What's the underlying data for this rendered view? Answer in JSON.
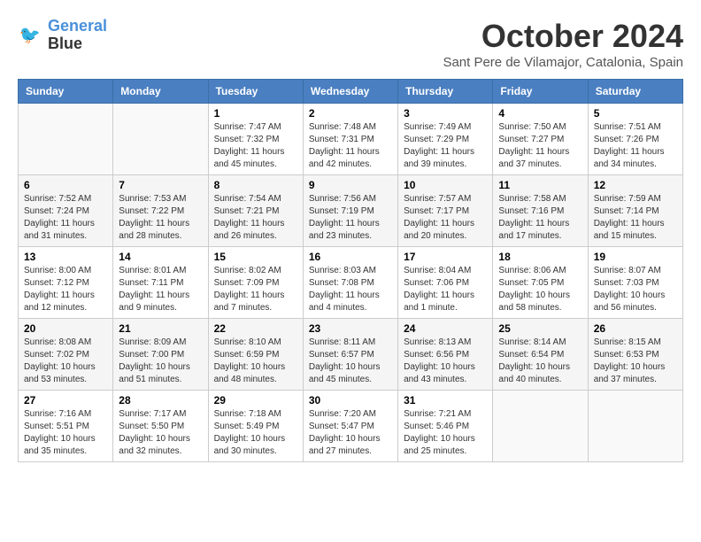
{
  "header": {
    "logo_line1": "General",
    "logo_line2": "Blue",
    "month": "October 2024",
    "location": "Sant Pere de Vilamajor, Catalonia, Spain"
  },
  "weekdays": [
    "Sunday",
    "Monday",
    "Tuesday",
    "Wednesday",
    "Thursday",
    "Friday",
    "Saturday"
  ],
  "weeks": [
    [
      {
        "day": "",
        "sunrise": "",
        "sunset": "",
        "daylight": ""
      },
      {
        "day": "",
        "sunrise": "",
        "sunset": "",
        "daylight": ""
      },
      {
        "day": "1",
        "sunrise": "Sunrise: 7:47 AM",
        "sunset": "Sunset: 7:32 PM",
        "daylight": "Daylight: 11 hours and 45 minutes."
      },
      {
        "day": "2",
        "sunrise": "Sunrise: 7:48 AM",
        "sunset": "Sunset: 7:31 PM",
        "daylight": "Daylight: 11 hours and 42 minutes."
      },
      {
        "day": "3",
        "sunrise": "Sunrise: 7:49 AM",
        "sunset": "Sunset: 7:29 PM",
        "daylight": "Daylight: 11 hours and 39 minutes."
      },
      {
        "day": "4",
        "sunrise": "Sunrise: 7:50 AM",
        "sunset": "Sunset: 7:27 PM",
        "daylight": "Daylight: 11 hours and 37 minutes."
      },
      {
        "day": "5",
        "sunrise": "Sunrise: 7:51 AM",
        "sunset": "Sunset: 7:26 PM",
        "daylight": "Daylight: 11 hours and 34 minutes."
      }
    ],
    [
      {
        "day": "6",
        "sunrise": "Sunrise: 7:52 AM",
        "sunset": "Sunset: 7:24 PM",
        "daylight": "Daylight: 11 hours and 31 minutes."
      },
      {
        "day": "7",
        "sunrise": "Sunrise: 7:53 AM",
        "sunset": "Sunset: 7:22 PM",
        "daylight": "Daylight: 11 hours and 28 minutes."
      },
      {
        "day": "8",
        "sunrise": "Sunrise: 7:54 AM",
        "sunset": "Sunset: 7:21 PM",
        "daylight": "Daylight: 11 hours and 26 minutes."
      },
      {
        "day": "9",
        "sunrise": "Sunrise: 7:56 AM",
        "sunset": "Sunset: 7:19 PM",
        "daylight": "Daylight: 11 hours and 23 minutes."
      },
      {
        "day": "10",
        "sunrise": "Sunrise: 7:57 AM",
        "sunset": "Sunset: 7:17 PM",
        "daylight": "Daylight: 11 hours and 20 minutes."
      },
      {
        "day": "11",
        "sunrise": "Sunrise: 7:58 AM",
        "sunset": "Sunset: 7:16 PM",
        "daylight": "Daylight: 11 hours and 17 minutes."
      },
      {
        "day": "12",
        "sunrise": "Sunrise: 7:59 AM",
        "sunset": "Sunset: 7:14 PM",
        "daylight": "Daylight: 11 hours and 15 minutes."
      }
    ],
    [
      {
        "day": "13",
        "sunrise": "Sunrise: 8:00 AM",
        "sunset": "Sunset: 7:12 PM",
        "daylight": "Daylight: 11 hours and 12 minutes."
      },
      {
        "day": "14",
        "sunrise": "Sunrise: 8:01 AM",
        "sunset": "Sunset: 7:11 PM",
        "daylight": "Daylight: 11 hours and 9 minutes."
      },
      {
        "day": "15",
        "sunrise": "Sunrise: 8:02 AM",
        "sunset": "Sunset: 7:09 PM",
        "daylight": "Daylight: 11 hours and 7 minutes."
      },
      {
        "day": "16",
        "sunrise": "Sunrise: 8:03 AM",
        "sunset": "Sunset: 7:08 PM",
        "daylight": "Daylight: 11 hours and 4 minutes."
      },
      {
        "day": "17",
        "sunrise": "Sunrise: 8:04 AM",
        "sunset": "Sunset: 7:06 PM",
        "daylight": "Daylight: 11 hours and 1 minute."
      },
      {
        "day": "18",
        "sunrise": "Sunrise: 8:06 AM",
        "sunset": "Sunset: 7:05 PM",
        "daylight": "Daylight: 10 hours and 58 minutes."
      },
      {
        "day": "19",
        "sunrise": "Sunrise: 8:07 AM",
        "sunset": "Sunset: 7:03 PM",
        "daylight": "Daylight: 10 hours and 56 minutes."
      }
    ],
    [
      {
        "day": "20",
        "sunrise": "Sunrise: 8:08 AM",
        "sunset": "Sunset: 7:02 PM",
        "daylight": "Daylight: 10 hours and 53 minutes."
      },
      {
        "day": "21",
        "sunrise": "Sunrise: 8:09 AM",
        "sunset": "Sunset: 7:00 PM",
        "daylight": "Daylight: 10 hours and 51 minutes."
      },
      {
        "day": "22",
        "sunrise": "Sunrise: 8:10 AM",
        "sunset": "Sunset: 6:59 PM",
        "daylight": "Daylight: 10 hours and 48 minutes."
      },
      {
        "day": "23",
        "sunrise": "Sunrise: 8:11 AM",
        "sunset": "Sunset: 6:57 PM",
        "daylight": "Daylight: 10 hours and 45 minutes."
      },
      {
        "day": "24",
        "sunrise": "Sunrise: 8:13 AM",
        "sunset": "Sunset: 6:56 PM",
        "daylight": "Daylight: 10 hours and 43 minutes."
      },
      {
        "day": "25",
        "sunrise": "Sunrise: 8:14 AM",
        "sunset": "Sunset: 6:54 PM",
        "daylight": "Daylight: 10 hours and 40 minutes."
      },
      {
        "day": "26",
        "sunrise": "Sunrise: 8:15 AM",
        "sunset": "Sunset: 6:53 PM",
        "daylight": "Daylight: 10 hours and 37 minutes."
      }
    ],
    [
      {
        "day": "27",
        "sunrise": "Sunrise: 7:16 AM",
        "sunset": "Sunset: 5:51 PM",
        "daylight": "Daylight: 10 hours and 35 minutes."
      },
      {
        "day": "28",
        "sunrise": "Sunrise: 7:17 AM",
        "sunset": "Sunset: 5:50 PM",
        "daylight": "Daylight: 10 hours and 32 minutes."
      },
      {
        "day": "29",
        "sunrise": "Sunrise: 7:18 AM",
        "sunset": "Sunset: 5:49 PM",
        "daylight": "Daylight: 10 hours and 30 minutes."
      },
      {
        "day": "30",
        "sunrise": "Sunrise: 7:20 AM",
        "sunset": "Sunset: 5:47 PM",
        "daylight": "Daylight: 10 hours and 27 minutes."
      },
      {
        "day": "31",
        "sunrise": "Sunrise: 7:21 AM",
        "sunset": "Sunset: 5:46 PM",
        "daylight": "Daylight: 10 hours and 25 minutes."
      },
      {
        "day": "",
        "sunrise": "",
        "sunset": "",
        "daylight": ""
      },
      {
        "day": "",
        "sunrise": "",
        "sunset": "",
        "daylight": ""
      }
    ]
  ]
}
